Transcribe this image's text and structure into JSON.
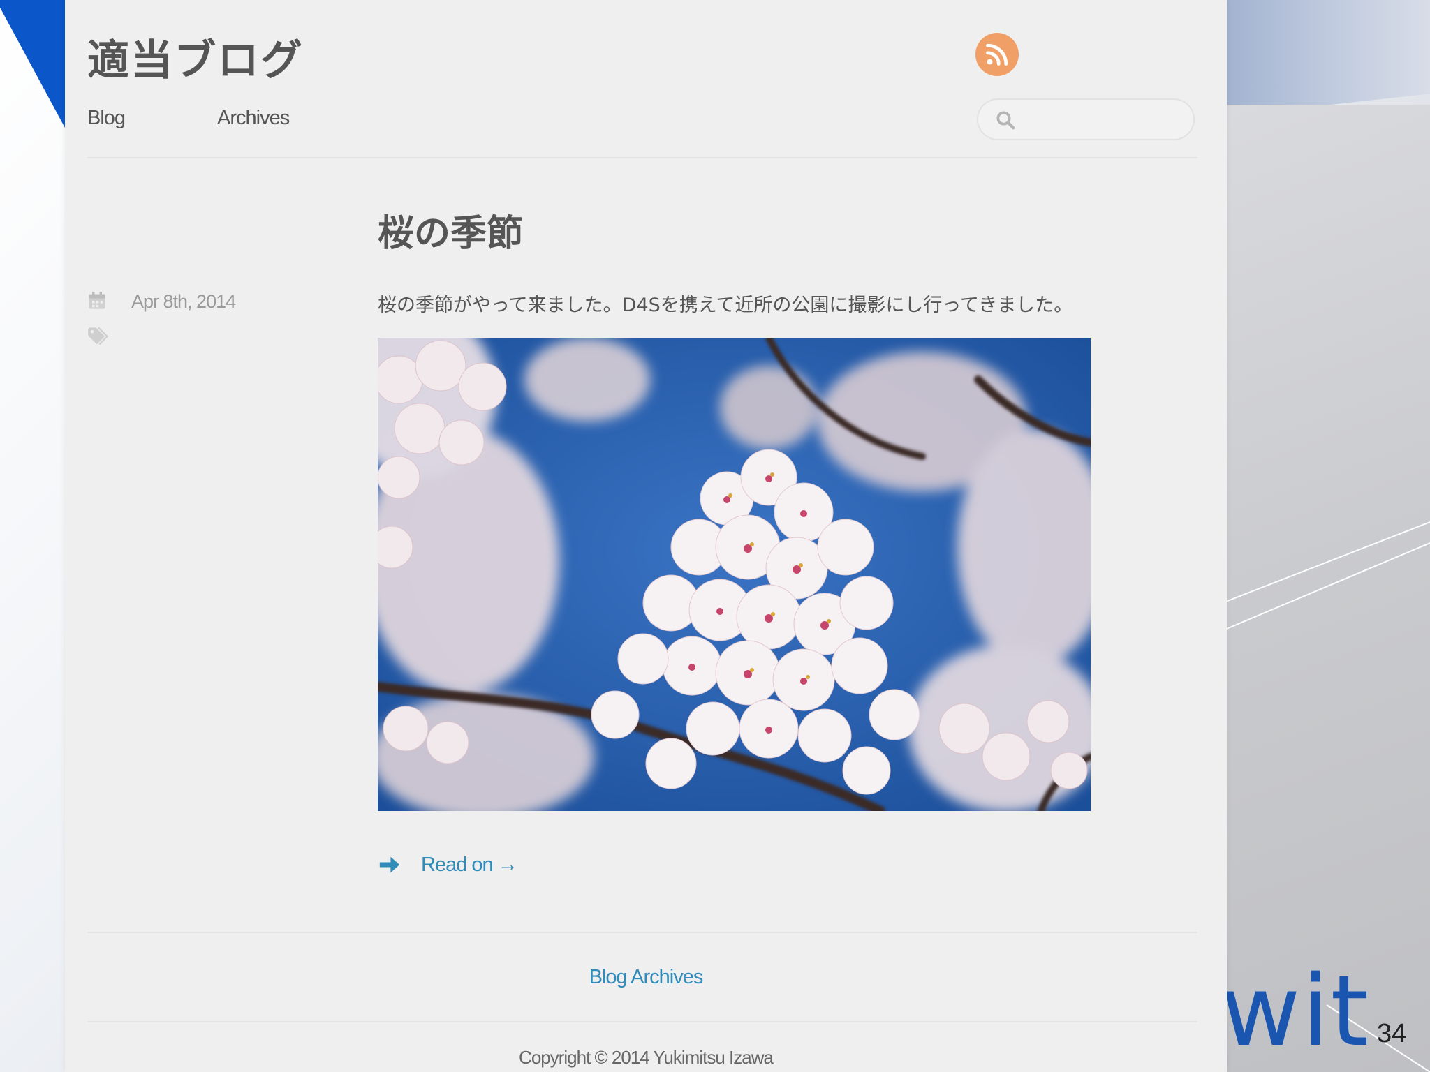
{
  "site": {
    "title": "適当ブログ",
    "nav": [
      {
        "label": "Blog"
      },
      {
        "label": "Archives"
      }
    ],
    "search": {
      "placeholder": ""
    },
    "rss_icon": "rss-icon"
  },
  "post": {
    "title": "桜の季節",
    "date": "Apr 8th, 2014",
    "excerpt": "桜の季節がやって来ました。D4Sを携えて近所の公園に撮影にし行ってきました。",
    "image": "cherry-blossom-photo",
    "read_on": "Read on →"
  },
  "footer": {
    "archives_link": "Blog Archives",
    "copyright": "Copyright © 2014 Yukimitsu Izawa"
  },
  "slide": {
    "brand": "wit",
    "page_number": "34"
  },
  "colors": {
    "link": "#2f8bb8",
    "rss": "#f0a066",
    "accent_blue": "#0b57c9"
  }
}
